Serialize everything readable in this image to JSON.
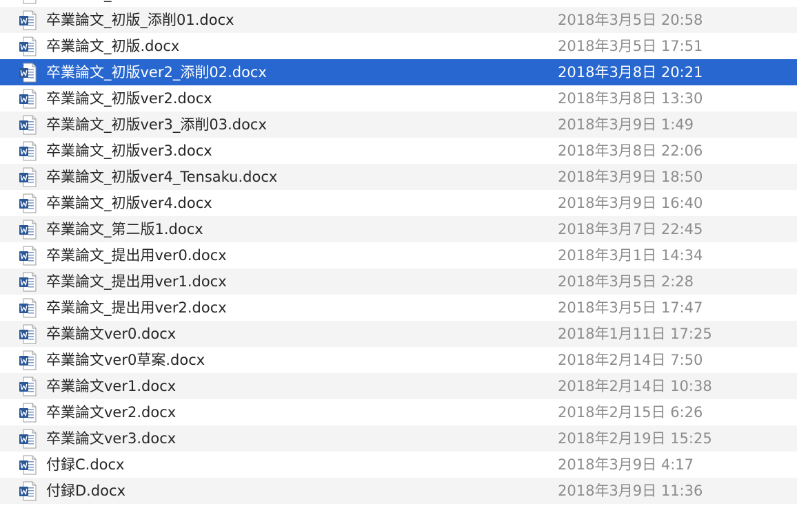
{
  "colors": {
    "selection": "#2767cf",
    "row_alt": "#f4f4f5",
    "name_text": "#262626",
    "date_text": "#8c8c8c",
    "word_blue": "#2b5797"
  },
  "icon_name": "word-document-icon",
  "files": [
    {
      "name": "卒業論文_提出用ver2.docx",
      "date": "2018年3月5日 17:47",
      "selected": false,
      "partial": true
    },
    {
      "name": "卒業論文_初版_添削01.docx",
      "date": "2018年3月5日 20:58",
      "selected": false
    },
    {
      "name": "卒業論文_初版.docx",
      "date": "2018年3月5日 17:51",
      "selected": false
    },
    {
      "name": "卒業論文_初版ver2_添削02.docx",
      "date": "2018年3月8日 20:21",
      "selected": true
    },
    {
      "name": "卒業論文_初版ver2.docx",
      "date": "2018年3月8日 13:30",
      "selected": false
    },
    {
      "name": "卒業論文_初版ver3_添削03.docx",
      "date": "2018年3月9日 1:49",
      "selected": false
    },
    {
      "name": "卒業論文_初版ver3.docx",
      "date": "2018年3月8日 22:06",
      "selected": false
    },
    {
      "name": "卒業論文_初版ver4_Tensaku.docx",
      "date": "2018年3月9日 18:50",
      "selected": false
    },
    {
      "name": "卒業論文_初版ver4.docx",
      "date": "2018年3月9日 16:40",
      "selected": false
    },
    {
      "name": "卒業論文_第二版1.docx",
      "date": "2018年3月7日 22:45",
      "selected": false
    },
    {
      "name": "卒業論文_提出用ver0.docx",
      "date": "2018年3月1日 14:34",
      "selected": false
    },
    {
      "name": "卒業論文_提出用ver1.docx",
      "date": "2018年3月5日 2:28",
      "selected": false
    },
    {
      "name": "卒業論文_提出用ver2.docx",
      "date": "2018年3月5日 17:47",
      "selected": false
    },
    {
      "name": "卒業論文ver0.docx",
      "date": "2018年1月11日 17:25",
      "selected": false
    },
    {
      "name": "卒業論文ver0草案.docx",
      "date": "2018年2月14日 7:50",
      "selected": false
    },
    {
      "name": "卒業論文ver1.docx",
      "date": "2018年2月14日 10:38",
      "selected": false
    },
    {
      "name": "卒業論文ver2.docx",
      "date": "2018年2月15日 6:26",
      "selected": false
    },
    {
      "name": "卒業論文ver3.docx",
      "date": "2018年2月19日 15:25",
      "selected": false
    },
    {
      "name": "付録C.docx",
      "date": "2018年3月9日 4:17",
      "selected": false
    },
    {
      "name": "付録D.docx",
      "date": "2018年3月9日 11:36",
      "selected": false
    },
    {
      "name": "",
      "date": "",
      "selected": false,
      "partial": true
    }
  ]
}
